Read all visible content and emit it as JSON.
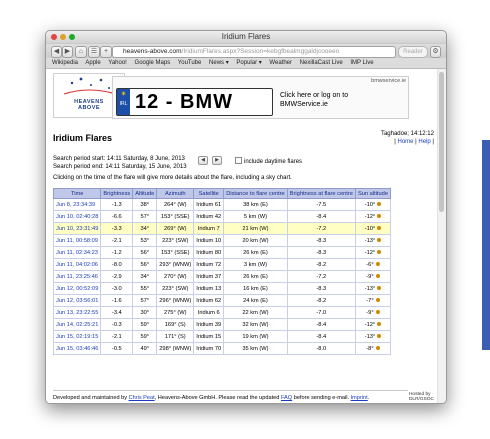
{
  "window": {
    "title": "Iridium Flares"
  },
  "colors": {
    "accent_blue": "#1a3cc1",
    "table_header": "#bfc8e8",
    "highlight_row": "#ffffc4"
  },
  "toolbar": {
    "url_host": "heavens-above.com",
    "url_path": "/IridiumFlares.aspx?Session=kebgfbealmggaldjcooeeo",
    "reader_label": "Reader",
    "back_icon": "back-arrow-icon",
    "forward_icon": "forward-arrow-icon"
  },
  "bookmarks": [
    "Wikipedia",
    "Apple",
    "Yahoo!",
    "Google Maps",
    "YouTube",
    "News ▾",
    "Popular ▾",
    "Weather",
    "NexillaCast Live",
    "IMP Live"
  ],
  "header": {
    "logo_line1": "HEAVENS",
    "logo_line2": "ABOVE",
    "ad_source": "bmwservice.ie",
    "plate_country": "IRL",
    "plate_text": "12 - BMW",
    "ad_cta_1": "Click here or log on to",
    "ad_cta_2": "BMWService.ie"
  },
  "page": {
    "title": "Iridium Flares",
    "location": "Taghadoe; 14:12:12",
    "home_link": "Home",
    "help_link": "Help",
    "period_start": "Search period start: 14:11 Saturday, 8 June, 2013",
    "period_end": "Search period end: 14:11 Saturday, 15 June, 2013",
    "prev_icon": "left-arrow-icon",
    "next_icon": "right-arrow-icon",
    "daylight_label": "include daytime flares",
    "instruction": "Clicking on the time of the flare will give more details about the flare, including a sky chart."
  },
  "table": {
    "columns": [
      "Time",
      "Brightness",
      "Altitude",
      "Azimuth",
      "Satellite",
      "Distance to flare centre",
      "Brightness at flare centre",
      "Sun altitude"
    ],
    "rows": [
      [
        "Jun 8, 23:34:39",
        "-1.3",
        "38°",
        "264° (W)",
        "Iridium 61",
        "38 km (E)",
        "-7.5",
        "-10°"
      ],
      [
        "Jun 10, 02:40:28",
        "-6.6",
        "57°",
        "153° (SSE)",
        "Iridium 42",
        "5 km (W)",
        "-8.4",
        "-12°"
      ],
      [
        "Jun 10, 23:31:49",
        "-3.3",
        "34°",
        "269° (W)",
        "Iridium 7",
        "21 km (W)",
        "-7.2",
        "-10°"
      ],
      [
        "Jun 11, 00:58:09",
        "-2.1",
        "53°",
        "223° (SW)",
        "Iridium 10",
        "20 km (W)",
        "-8.3",
        "-13°"
      ],
      [
        "Jun 11, 02:34:23",
        "-1.2",
        "56°",
        "153° (SSE)",
        "Iridium 80",
        "26 km (E)",
        "-8.3",
        "-12°"
      ],
      [
        "Jun 11, 04:02:06",
        "-8.0",
        "56°",
        "293° (WNW)",
        "Iridium 72",
        "3 km (W)",
        "-8.2",
        "-6°"
      ],
      [
        "Jun 11, 23:25:46",
        "-2.9",
        "34°",
        "270° (W)",
        "Iridium 37",
        "26 km (E)",
        "-7.2",
        "-9°"
      ],
      [
        "Jun 12, 00:52:09",
        "-3.0",
        "55°",
        "223° (SW)",
        "Iridium 13",
        "16 km (E)",
        "-8.3",
        "-13°"
      ],
      [
        "Jun 12, 03:56:01",
        "-1.6",
        "57°",
        "296° (WNW)",
        "Iridium 62",
        "24 km (E)",
        "-8.2",
        "-7°"
      ],
      [
        "Jun 13, 23:22:55",
        "-3.4",
        "30°",
        "275° (W)",
        "Iridium 6",
        "22 km (W)",
        "-7.0",
        "-9°"
      ],
      [
        "Jun 14, 02:25:21",
        "-0.3",
        "59°",
        "169° (S)",
        "Iridium 39",
        "32 km (W)",
        "-8.4",
        "-12°"
      ],
      [
        "Jun 15, 02:19:15",
        "-2.1",
        "59°",
        "171° (S)",
        "Iridium 15",
        "19 km (W)",
        "-8.4",
        "-13°"
      ],
      [
        "Jun 15, 03:46:46",
        "-0.5",
        "49°",
        "298° (WNW)",
        "Iridium 70",
        "35 km (W)",
        "-8.0",
        "-8°"
      ]
    ],
    "highlighted_row": 2
  },
  "footer": {
    "text_1": "Developed and maintained by ",
    "author_link": "Chris Peat",
    "text_2": ", Heavens-Above GmbH. Please read the updated ",
    "faq_link": "FAQ",
    "text_3": " before sending e-mail. ",
    "imprint_link": "Imprint",
    "text_4": ".",
    "hosted_label": "Hosted by",
    "host_name": "DLR/GSOC"
  }
}
